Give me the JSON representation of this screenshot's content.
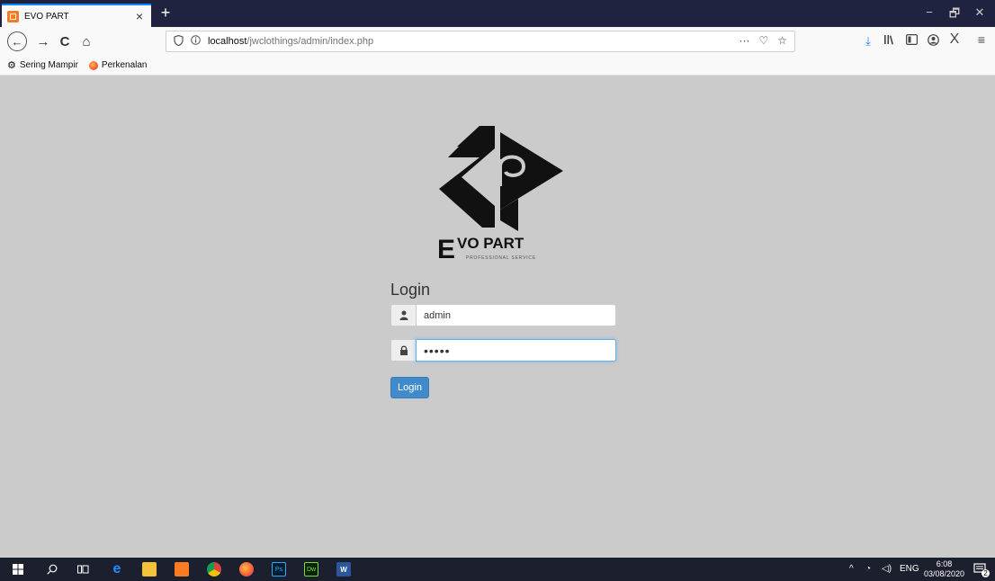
{
  "browser": {
    "tab_title": "EVO PART",
    "tab_close": "×",
    "new_tab": "+",
    "window_controls": {
      "minimize": "−",
      "restore": "🗗",
      "close": "✕"
    },
    "nav": {
      "back": "←",
      "forward": "→",
      "reload": "C",
      "home": "⌂"
    },
    "url": {
      "host": "localhost",
      "path": "/jwclothings/admin/index.php",
      "page_actions": "···",
      "pocket": "♡",
      "star": "☆"
    },
    "toolbar_icons": [
      "download-icon",
      "library-icon",
      "sidebar-icon",
      "account-icon",
      "extension-icon",
      "menu-icon"
    ],
    "bookmarks": [
      {
        "label": "Sering Mampir",
        "icon": "gear-icon"
      },
      {
        "label": "Perkenalan",
        "icon": "firefox-icon"
      }
    ]
  },
  "page": {
    "logo_text": "EVO PART",
    "logo_subtext": "PROFESSIONAL SERVICE",
    "login_title": "Login",
    "username_value": "admin",
    "password_value": "•••••",
    "login_button": "Login",
    "colors": {
      "background": "#cbcbcb",
      "button": "#428bca"
    }
  },
  "taskbar": {
    "apps": [
      "windows-start-icon",
      "search-icon",
      "task-view-icon",
      "edge-icon",
      "file-explorer-icon",
      "xampp-icon",
      "chrome-icon",
      "firefox-icon",
      "photoshop-icon",
      "dreamweaver-icon",
      "word-icon"
    ],
    "tray_language": "ENG",
    "time": "6:08",
    "date": "03/08/2020",
    "notification_count": "2"
  }
}
